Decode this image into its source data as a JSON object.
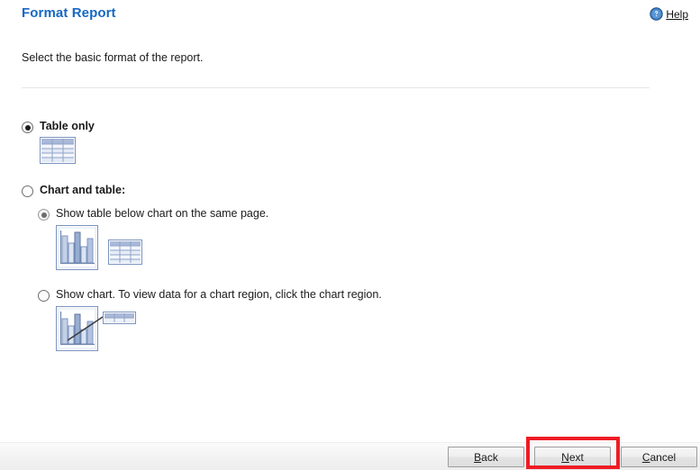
{
  "header": {
    "title": "Format Report",
    "help": {
      "label": "Help",
      "icon": "help-circle-icon"
    },
    "title_color": "#1668c1"
  },
  "intro": {
    "text": "Select the basic format of the report."
  },
  "options": {
    "table_only": {
      "label": "Table only",
      "selected": true,
      "icon": "table-icon"
    },
    "chart_and_table": {
      "label": "Chart and table:",
      "selected": false,
      "sub_options": [
        {
          "label": "Show table below chart on the same page.",
          "selected": true,
          "icon": "chart-and-table-icon"
        },
        {
          "label": "Show chart. To view data for a chart region, click the chart region.",
          "selected": false,
          "icon": "chart-drilldown-icon"
        }
      ]
    }
  },
  "footer": {
    "buttons": [
      {
        "name": "back",
        "label": "Back",
        "accel": "B",
        "highlighted": false
      },
      {
        "name": "next",
        "label": "Next",
        "accel": "N",
        "highlighted": true
      },
      {
        "name": "cancel",
        "label": "Cancel",
        "accel": "C",
        "highlighted": false
      }
    ],
    "highlight_color": "#ee1c25"
  }
}
